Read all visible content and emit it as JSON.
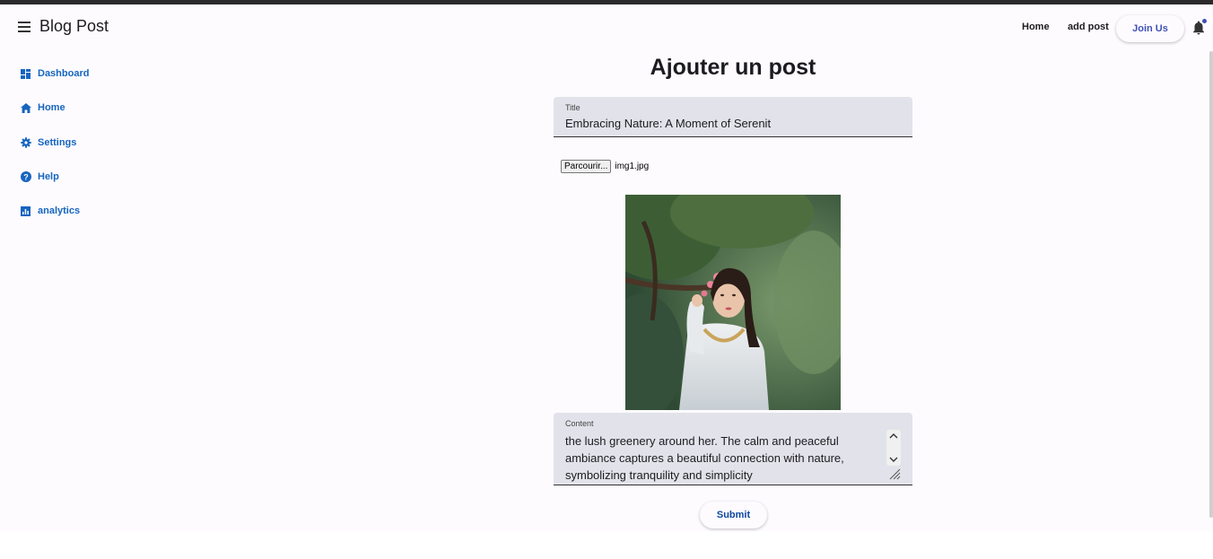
{
  "toolbar": {
    "app_title": "Blog Post",
    "nav": [
      {
        "label": "Home"
      },
      {
        "label": "add post"
      }
    ],
    "join_label": "Join Us"
  },
  "sidebar": {
    "items": [
      {
        "label": "Dashboard",
        "icon": "dashboard-icon"
      },
      {
        "label": "Home",
        "icon": "home-icon"
      },
      {
        "label": "Settings",
        "icon": "gear-icon"
      },
      {
        "label": "Help",
        "icon": "help-icon"
      },
      {
        "label": "analytics",
        "icon": "analytics-icon"
      }
    ]
  },
  "form": {
    "heading": "Ajouter un post",
    "title_label": "Title",
    "title_value": "Embracing Nature: A Moment of Serenit",
    "file_button": "Parcourir...",
    "file_name": "img1.jpg",
    "content_label": "Content",
    "content_value": "the lush greenery around her. The calm and peaceful\nambiance captures a beautiful connection with nature,\nsymbolizing tranquility and simplicity",
    "submit_label": "Submit"
  },
  "colors": {
    "accent": "#3f51b5",
    "link": "#1565c0",
    "field_bg": "#e2e2ea",
    "page_bg": "#fdfbfe"
  }
}
